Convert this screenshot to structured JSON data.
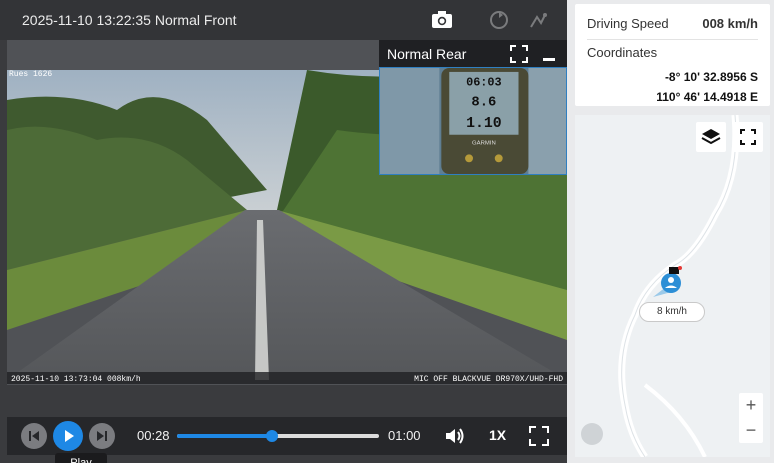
{
  "header": {
    "title": "2025-11-10 13:22:35 Normal Front"
  },
  "rear": {
    "label": "Normal Rear",
    "gps_time": "06:03",
    "gps_speed": "8.6",
    "gps_dist": "1.10",
    "gps_brand": "GARMIN"
  },
  "front_overlay": {
    "corner_tag": "Rues 1626",
    "timestamp": "2025-11-10 13:73:04 008km/h",
    "device": "MIC OFF BLACKVUE DR970X/UHD-FHD"
  },
  "player": {
    "current_time": "00:28",
    "total_time": "01:00",
    "progress": 0.47,
    "rate": "1X",
    "tooltip": "Play"
  },
  "info": {
    "speed_label": "Driving Speed",
    "speed_value": "008 km/h",
    "coord_label": "Coordinates",
    "lat": "-8° 10' 32.8956 S",
    "lon": "110° 46' 14.4918 E"
  },
  "map": {
    "speed_tag": "8 km/h",
    "zoom_in": "+",
    "zoom_out": "−"
  },
  "colors": {
    "accent": "#1e88e5",
    "dark_bar": "#333437",
    "controls_bg": "#26272a"
  }
}
